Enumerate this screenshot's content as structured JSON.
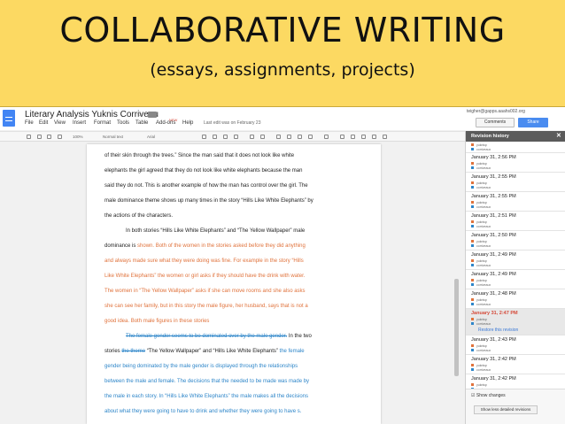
{
  "slide": {
    "title": "COLLABORATIVE WRITING",
    "subtitle": "(essays, assignments, projects)"
  },
  "docs": {
    "title": "Literary Analysis Yuknis Corriveau",
    "menu": [
      "File",
      "Edit",
      "View",
      "Insert",
      "Format",
      "Tools",
      "Table",
      "Add-ons",
      "Help"
    ],
    "new_badge": "NEW",
    "last_edit": "Last edit was on February 23",
    "user_email": "teigher@gapps.aaahs002.org",
    "comments_label": "Comments",
    "share_label": "Share",
    "toolbar": {
      "zoom": "100%",
      "style": "Normal text",
      "font": "Arial"
    }
  },
  "document": {
    "l1": "of their skin through the trees.” Since the man said that it does not look like white",
    "l2": "elephants the girl agreed that they do not look like white elephants because the man",
    "l3": "said they do not. This is another example of how the man has control over the girl. The",
    "l4": "male dominance theme shows up many times in the story “Hills Like White Elephants” by",
    "l5": "the actions of the characters.",
    "l6": "In both stories “Hills Like White Elephants” and “The Yellow Wallpaper” male",
    "l7a": "dominance is ",
    "l7b": "shown. Both of the women in the stories asked before they did anything",
    "l8": "and always made sure what they were doing was fine. For example in the story “Hills",
    "l9": "Like White Elephants” the women or girl asks if they should have the drink with water.",
    "l10": "The women in “The Yellow Wallpaper” asks if she can move rooms and she also asks",
    "l11": "she can see her family, but in this story the male figure, her husband, says that is not a",
    "l12": "good idea. Both male figures in these stories",
    "l13a": "The female gender seems to be dominated over by the male gender.",
    "l13b": " In the two",
    "l14a": "stories ",
    "l14b": "the theme",
    "l14c": " “The Yellow Wallpaper” and “Hills Like White Elephants”",
    "l14d": " the female",
    "l15": "gender being dominated by the male gender is displayed through the relationships",
    "l16": "between the male and female. The decisions that the needed to be made was made by",
    "l17": "the male in each story. In “Hills Like White Elephants” the male makes all the decisions",
    "l18": "about what they were going to have to drink and whether they were going to have s."
  },
  "revision_history": {
    "header": "Revision history",
    "restore_label": "Restore this revision",
    "show_changes_label": "Show changes",
    "less_detail_label": "Show less detailed revisions",
    "author_colors": [
      "#e0723b",
      "#2e86c9"
    ],
    "entries": [
      {
        "time": "",
        "authors": [
          "yuknisp",
          "corriveaux"
        ]
      },
      {
        "time": "January 31, 2:56 PM",
        "authors": [
          "yuknisp",
          "corriveaux"
        ]
      },
      {
        "time": "January 31, 2:55 PM",
        "authors": [
          "yuknisp",
          "corriveaux"
        ]
      },
      {
        "time": "January 31, 2:55 PM",
        "authors": [
          "yuknisp",
          "corriveaux"
        ]
      },
      {
        "time": "January 31, 2:51 PM",
        "authors": [
          "yuknisp",
          "corriveaux"
        ]
      },
      {
        "time": "January 31, 2:50 PM",
        "authors": [
          "yuknisp",
          "corriveaux"
        ]
      },
      {
        "time": "January 31, 2:49 PM",
        "authors": [
          "yuknisp",
          "corriveaux"
        ]
      },
      {
        "time": "January 31, 2:49 PM",
        "authors": [
          "yuknisp",
          "corriveaux"
        ]
      },
      {
        "time": "January 31, 2:48 PM",
        "authors": [
          "yuknisp",
          "corriveaux"
        ]
      },
      {
        "time": "January 31, 2:47 PM",
        "authors": [
          "yuknisp",
          "corriveaux"
        ],
        "selected": true
      },
      {
        "time": "January 31, 2:43 PM",
        "authors": [
          "yuknisp",
          "corriveaux"
        ]
      },
      {
        "time": "January 31, 2:42 PM",
        "authors": [
          "yuknisp",
          "corriveaux"
        ]
      },
      {
        "time": "January 31, 2:42 PM",
        "authors": [
          "yuknisp",
          "corriveaux"
        ]
      }
    ]
  }
}
